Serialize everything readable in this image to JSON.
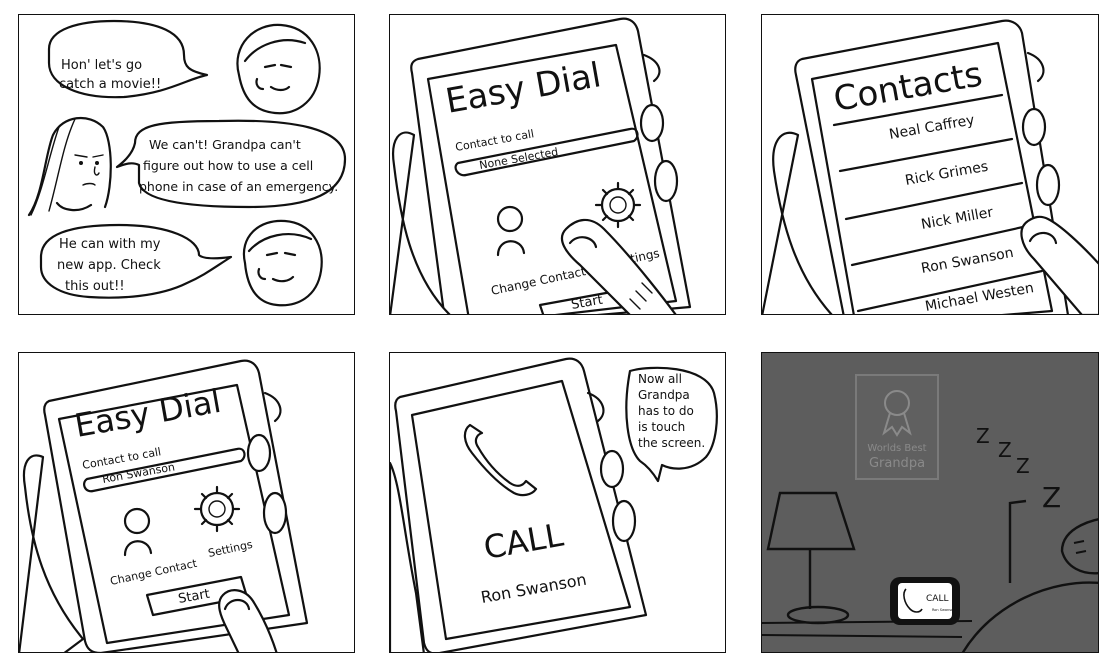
{
  "panel1": {
    "bubble_top": [
      "Hon' let's go",
      "catch a movie!!"
    ],
    "bubble_mid": [
      "We can't! Grandpa can't",
      "figure out how to use a cell",
      "phone in case of an emergency."
    ],
    "bubble_bottom": [
      "He can with my",
      "new app. Check",
      "this out!!"
    ]
  },
  "panel2": {
    "app_title": "Easy Dial",
    "contact_label": "Contact to call",
    "contact_value": "None Selected",
    "change_contact_label": "Change Contact",
    "settings_label": "Settings",
    "start_label": "Start"
  },
  "panel3": {
    "title": "Contacts",
    "contacts": [
      "Neal Caffrey",
      "Rick Grimes",
      "Nick Miller",
      "Ron Swanson",
      "Michael Westen"
    ]
  },
  "panel4": {
    "app_title": "Easy Dial",
    "contact_label": "Contact to call",
    "contact_value": "Ron Swanson",
    "change_contact_label": "Change Contact",
    "settings_label": "Settings",
    "start_label": "Start"
  },
  "panel5": {
    "call_label": "CALL",
    "callee": "Ron Swanson",
    "bubble": [
      "Now all",
      "Grandpa",
      "has to do",
      "is touch",
      "the screen."
    ]
  },
  "panel6": {
    "poster": [
      "Worlds Best",
      "Grandpa"
    ],
    "snore": [
      "Z",
      "Z",
      "Z",
      "Z"
    ],
    "phone_call_label": "CALL",
    "phone_callee": "Ron Swanson",
    "background_color": "#5d5d5d"
  }
}
